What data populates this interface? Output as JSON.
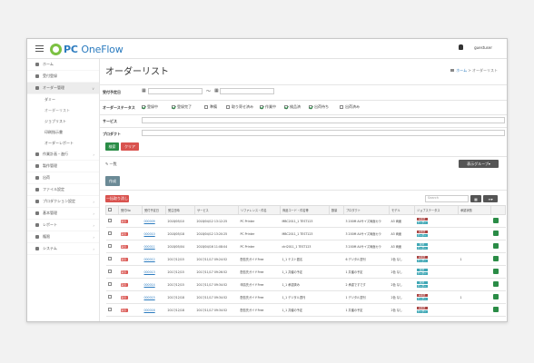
{
  "app": {
    "logo_pc": "PC",
    "logo_brand": "OneFlow",
    "user": "guestuser"
  },
  "sidebar": {
    "items": [
      {
        "label": "ホーム"
      },
      {
        "label": "受付登録"
      },
      {
        "label": "オーダー管理"
      },
      {
        "label": "ダミー"
      },
      {
        "label": "オーダーリスト"
      },
      {
        "label": "ジョブリスト"
      },
      {
        "label": "印刷指示書"
      },
      {
        "label": "オーダーレポート"
      },
      {
        "label": "作業計画・進行"
      },
      {
        "label": "製作管理"
      },
      {
        "label": "出荷"
      },
      {
        "label": "ファイル設定"
      },
      {
        "label": "プロダクション設定"
      },
      {
        "label": "基本管理"
      },
      {
        "label": "レポート"
      },
      {
        "label": "権限"
      },
      {
        "label": "システム"
      }
    ]
  },
  "page": {
    "title": "オーダーリスト",
    "crumb_home": "ホーム",
    "crumb_sep": ">",
    "crumb_current": "オーダーリスト"
  },
  "filters": {
    "date_label": "受付予定日",
    "date_sep": "〜",
    "status_label": "オーダーステータス",
    "statuses": [
      "登録中",
      "登録完了",
      "準備",
      "取り寄せ済み",
      "作業中",
      "検品済",
      "出荷待ち",
      "出荷済み"
    ],
    "service_label": "サービス",
    "product_label": "プロダクト",
    "search_btn": "検索",
    "clear_btn": "クリア"
  },
  "toolbar": {
    "result_title": "一覧",
    "group_btn": "表示グループ",
    "new_btn": "作成",
    "bulk_delete_btn": "一括取り消し",
    "search_placeholder": "Search"
  },
  "table": {
    "headers": [
      "",
      "受付No",
      "受付予定日",
      "受注日時",
      "サービス",
      "リファレンス・件名",
      "商品コード・件名等",
      "数量",
      "プロダクト",
      "モデル",
      "ジョブステータス",
      "承認状態",
      ""
    ],
    "rows": [
      {
        "tag": "取引",
        "no": "000009",
        "date": "2018/05/10",
        "datetime": "2018/04/12 13:12:25",
        "service": "PC Printer",
        "ref": "MBC2011_1 TEST123",
        "qty": "",
        "product": "3 200M A4サイズ両面カラ",
        "model": "A3 両面",
        "status": [
          "未確認",
          "オーダー確定"
        ],
        "approve": ""
      },
      {
        "tag": "取引",
        "no": "000010",
        "date": "2018/05/18",
        "datetime": "2018/04/12 13:20:25",
        "service": "PC Printer",
        "ref": "MBC2011_1 TEST123",
        "qty": "",
        "product": "3 200M A4サイズ両面カラ",
        "model": "A3 両面",
        "status": [
          "未確認",
          "オーダー確定"
        ],
        "approve": ""
      },
      {
        "tag": "取引",
        "no": "000011",
        "date": "2018/05/04",
        "datetime": "2018/04/16 11:08:04",
        "service": "PC Printer",
        "ref": "ctrl2011_1 TEST123",
        "qty": "",
        "product": "3 200M A4サイズ両面カラ",
        "model": "A3 両面",
        "status": [
          "取消",
          "オーダー確定"
        ],
        "approve": ""
      },
      {
        "tag": "取引",
        "no": "000012",
        "date": "2017/12/15",
        "datetime": "2017/11/17 09:24:52",
        "service": "配信先ガイドFree",
        "ref": "1_1 テスト題名",
        "qty": "",
        "product": "6 デジタル週刊",
        "model": "2色 なし",
        "status": [
          "未確認",
          "オーダー確定"
        ],
        "approve": "1"
      },
      {
        "tag": "取引",
        "no": "000013",
        "date": "2017/12/15",
        "datetime": "2017/11/17 09:26:52",
        "service": "配信先ガイドFree",
        "ref": "1_1 共催の予定",
        "qty": "",
        "product": "1 共催の予定",
        "model": "2色 なし",
        "status": [
          "取消",
          "オーダー確定"
        ],
        "approve": ""
      },
      {
        "tag": "取引",
        "no": "000014",
        "date": "2017/12/15",
        "datetime": "2017/11/17 09:34:52",
        "service": "申請先ガイドFree",
        "ref": "1_1 承認済み",
        "qty": "",
        "product": "2 承認ですです",
        "model": "2色 なし",
        "status": [
          "取消",
          "オーダー確定"
        ],
        "approve": ""
      },
      {
        "tag": "取引",
        "no": "000015",
        "date": "2017/12/18",
        "datetime": "2017/11/17 09:34:52",
        "service": "配信先ガイドFree",
        "ref": "1_1 デジタル週刊",
        "qty": "",
        "product": "1 デジタル週刊",
        "model": "2色 なし",
        "status": [
          "未確認",
          "オーダー確定"
        ],
        "approve": "1"
      },
      {
        "tag": "取引",
        "no": "000016",
        "date": "2017/12/18",
        "datetime": "2017/11/17 09:34:52",
        "service": "配信先ガイドFree",
        "ref": "1_1 共催の予定",
        "qty": "",
        "product": "1 共催の予定",
        "model": "2色 なし",
        "status": [
          "未確認",
          "オーダー確定"
        ],
        "approve": ""
      }
    ]
  },
  "colors": {
    "accent": "#2b7bbf",
    "logo_green": "#7cc142",
    "search_green": "#2a8c46",
    "clear_red": "#d9534f",
    "status_red": "#a94442",
    "status_teal": "#3fa7b5",
    "dark_btn": "#555555",
    "new_btn": "#6b8a96"
  }
}
